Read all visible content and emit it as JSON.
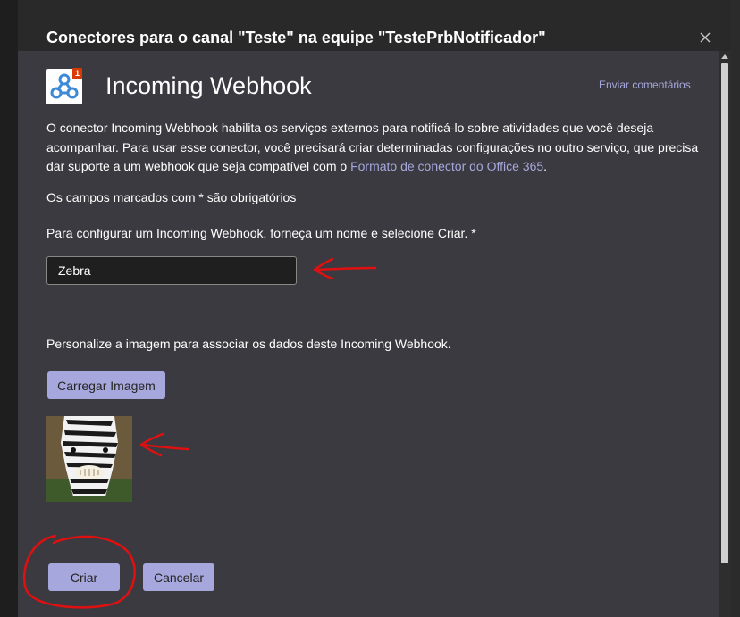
{
  "dialog": {
    "title": "Conectores para o canal \"Teste\" na equipe \"TestePrbNotificador\""
  },
  "connector": {
    "name": "Incoming Webhook",
    "logo_badge": "1",
    "feedback_link": "Enviar comentários"
  },
  "description": {
    "text": "O conector Incoming Webhook habilita os serviços externos para notificá-lo sobre atividades que você deseja acompanhar. Para usar esse conector, você precisará criar determinadas configurações no outro serviço, que precisa dar suporte a um webhook que seja compatível com o ",
    "link_text": "Formato de conector do Office 365",
    "suffix": "."
  },
  "form": {
    "required_note": "Os campos marcados com * são obrigatórios",
    "name_instruction": "Para configurar um Incoming Webhook, forneça um nome e selecione Criar. *",
    "name_value": "Zebra",
    "image_instruction": "Personalize a imagem para associar os dados deste Incoming Webhook.",
    "upload_label": "Carregar Imagem"
  },
  "actions": {
    "create_label": "Criar",
    "cancel_label": "Cancelar"
  },
  "colors": {
    "accent": "#a6a7dc",
    "annotation": "#e01010"
  }
}
